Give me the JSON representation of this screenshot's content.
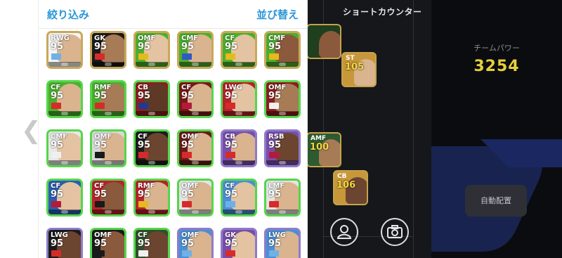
{
  "header": {
    "filter_label": "絞り込み",
    "sort_label": "並び替え"
  },
  "cards": [
    {
      "pos": "RWG",
      "rating": "95",
      "border": "gold",
      "bg": "#f4f4f4",
      "skin": "#d9b48f",
      "flag": "#6fb0e6"
    },
    {
      "pos": "GK",
      "rating": "95",
      "border": "gold",
      "bg": "#1a1a1a",
      "skin": "#a77b56",
      "flag": "#d62b2b"
    },
    {
      "pos": "OMF",
      "rating": "95",
      "border": "gold",
      "bg": "#4ab02c",
      "skin": "#e3c3a1",
      "flag": "#e6b91c"
    },
    {
      "pos": "CMF",
      "rating": "95",
      "border": "gold",
      "bg": "#4ab02c",
      "skin": "#d9b48f",
      "flag": "#2f59c4"
    },
    {
      "pos": "CF",
      "rating": "95",
      "border": "gold",
      "bg": "#4ab02c",
      "skin": "#e3c3a1",
      "flag": "#e6b91c"
    },
    {
      "pos": "CMF",
      "rating": "95",
      "border": "gold",
      "bg": "#4ab02c",
      "skin": "#8b5a3c",
      "flag": "#e6b91c"
    },
    {
      "pos": "CF",
      "rating": "95",
      "border": "green",
      "bg": "#4ab02c",
      "skin": "#d9b48f",
      "flag": "#d62b2b"
    },
    {
      "pos": "RMF",
      "rating": "95",
      "border": "green",
      "bg": "#4ab02c",
      "skin": "#a77b56",
      "flag": "#d62b2b"
    },
    {
      "pos": "CB",
      "rating": "95",
      "border": "green",
      "bg": "#8b1e1e",
      "skin": "#5e3a26",
      "flag": "#213a8f"
    },
    {
      "pos": "CF",
      "rating": "95",
      "border": "green",
      "bg": "#7a1818",
      "skin": "#d9b48f",
      "flag": "#b31b3a"
    },
    {
      "pos": "LWG",
      "rating": "95",
      "border": "green",
      "bg": "#b8222a",
      "skin": "#e3c3a1",
      "flag": "#d62b2b"
    },
    {
      "pos": "OMF",
      "rating": "95",
      "border": "green",
      "bg": "#8b1e1e",
      "skin": "#a77b56",
      "flag": "#f0f0f0"
    },
    {
      "pos": "CMF",
      "rating": "95",
      "border": "green",
      "bg": "#e8e8e8",
      "skin": "#e3c3a1",
      "flag": "#f0f0f0"
    },
    {
      "pos": "OMF",
      "rating": "95",
      "border": "green",
      "bg": "#d9d9d9",
      "skin": "#d9b48f",
      "flag": "#1a1a1a"
    },
    {
      "pos": "CF",
      "rating": "95",
      "border": "green",
      "bg": "#1c1c1c",
      "skin": "#6b4530",
      "flag": "#d62b2b"
    },
    {
      "pos": "OMF",
      "rating": "95",
      "border": "green",
      "bg": "#6a1a1a",
      "skin": "#d9b48f",
      "flag": "#d62b2b"
    },
    {
      "pos": "CB",
      "rating": "95",
      "border": "purple",
      "bg": "#7a4dad",
      "skin": "#d9b48f",
      "flag": "#d62b2b"
    },
    {
      "pos": "RSB",
      "rating": "95",
      "border": "purple",
      "bg": "#7a4dad",
      "skin": "#6b4530",
      "flag": "#b31b3a"
    },
    {
      "pos": "CF",
      "rating": "95",
      "border": "green",
      "bg": "#2a5db3",
      "skin": "#e3c3a1",
      "flag": "#b31b3a"
    },
    {
      "pos": "CF",
      "rating": "95",
      "border": "green",
      "bg": "#b8222a",
      "skin": "#8b5a3c",
      "flag": "#1a1a1a"
    },
    {
      "pos": "RMF",
      "rating": "95",
      "border": "green",
      "bg": "#b8222a",
      "skin": "#d9b48f",
      "flag": "#e6b91c"
    },
    {
      "pos": "OMF",
      "rating": "95",
      "border": "green",
      "bg": "#e4e4e4",
      "skin": "#d9b48f",
      "flag": "#d62b2b"
    },
    {
      "pos": "CF",
      "rating": "95",
      "border": "green",
      "bg": "#4a8fd6",
      "skin": "#e3c3a1",
      "flag": "#6fb0e6"
    },
    {
      "pos": "LMF",
      "rating": "95",
      "border": "green",
      "bg": "#e4e4e4",
      "skin": "#d9b48f",
      "flag": "#d62b2b"
    },
    {
      "pos": "LWG",
      "rating": "95",
      "border": "purple",
      "bg": "#1a1a1a",
      "skin": "#6b4530",
      "flag": "#d62b2b"
    },
    {
      "pos": "OMF",
      "rating": "95",
      "border": "green",
      "bg": "#1a1a1a",
      "skin": "#8b5a3c",
      "flag": "#1a1a1a"
    },
    {
      "pos": "CF",
      "rating": "95",
      "border": "green",
      "bg": "#2f4f2a",
      "skin": "#6b4530",
      "flag": "#f0f0f0"
    },
    {
      "pos": "OMF",
      "rating": "95",
      "border": "purple",
      "bg": "#4a8fd6",
      "skin": "#d9b48f",
      "flag": "#6fb0e6"
    },
    {
      "pos": "GK",
      "rating": "95",
      "border": "purple",
      "bg": "#7a4dad",
      "skin": "#e3c3a1",
      "flag": "#d62b2b"
    },
    {
      "pos": "LWG",
      "rating": "95",
      "border": "purple",
      "bg": "#4a8fd6",
      "skin": "#d9b48f",
      "flag": "#6fb0e6"
    }
  ],
  "field": {
    "title": "ショートカウンター",
    "players": [
      {
        "pos": "",
        "rating": "",
        "bg": "#1f3f1e",
        "skin": "#8b5a3c"
      },
      {
        "pos": "ST",
        "rating": "105",
        "bg": "#c7973a",
        "skin": "#d9b48f"
      },
      {
        "pos": "AMF",
        "rating": "100",
        "bg": "#2d5a30",
        "skin": "#a77b56"
      },
      {
        "pos": "CB",
        "rating": "106",
        "bg": "#c7973a",
        "skin": "#6b4530"
      }
    ]
  },
  "controls": {
    "person_icon": "person-icon",
    "camera_icon": "camera-icon"
  },
  "team": {
    "power_label": "チームパワー",
    "power_value": "3254",
    "auto_label": "自動配置"
  },
  "colors": {
    "accent": "#2a97d6",
    "power": "#e6cf3b"
  }
}
